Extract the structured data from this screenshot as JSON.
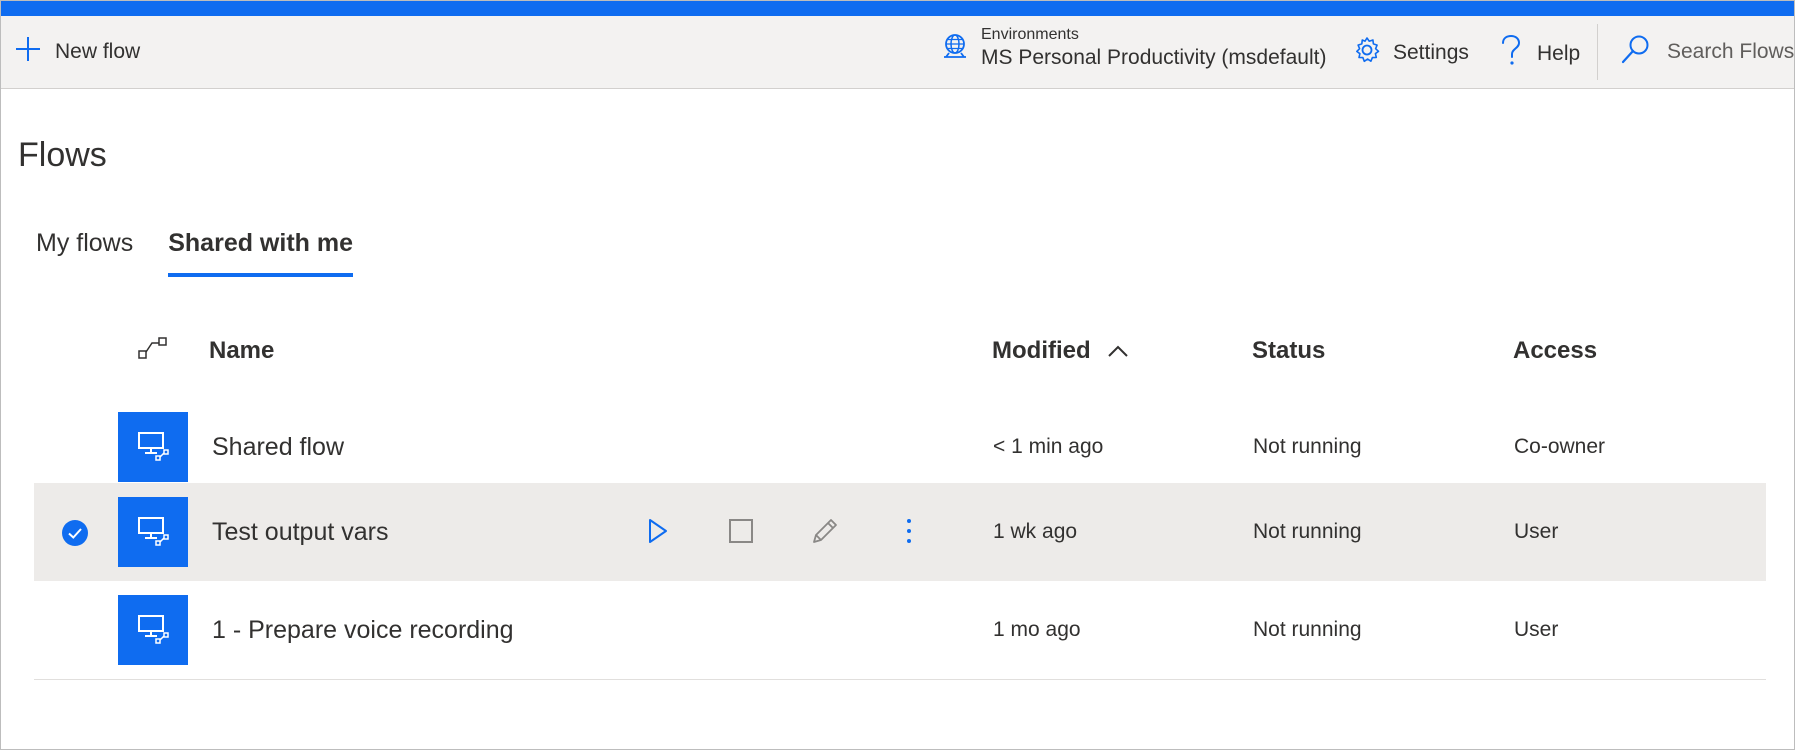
{
  "commandbar": {
    "new_flow_label": "New flow",
    "environments_caption": "Environments",
    "environment_value": "MS Personal Productivity (msdefault)",
    "settings_label": "Settings",
    "help_label": "Help",
    "search_placeholder": "Search Flows"
  },
  "page": {
    "title": "Flows",
    "tabs": [
      {
        "label": "My flows",
        "active": false
      },
      {
        "label": "Shared with me",
        "active": true
      }
    ]
  },
  "table": {
    "headers": {
      "name": "Name",
      "modified": "Modified",
      "status": "Status",
      "access": "Access"
    },
    "sort": {
      "column": "Modified",
      "direction": "ascending"
    },
    "rows": [
      {
        "name": "Shared flow",
        "modified": "< 1 min ago",
        "status": "Not running",
        "access": "Co-owner",
        "selected": false
      },
      {
        "name": "Test output vars",
        "modified": "1 wk ago",
        "status": "Not running",
        "access": "User",
        "selected": true
      },
      {
        "name": "1 - Prepare voice recording",
        "modified": "1 mo ago",
        "status": "Not running",
        "access": "User",
        "selected": false
      }
    ]
  },
  "colors": {
    "accent": "#0f6cf0",
    "command_bar": "#f3f2f1",
    "selected_row": "#edebe9",
    "text": "#323130"
  },
  "icons": {
    "new_flow": "plus-icon",
    "environments": "globe-icon",
    "settings": "gear-icon",
    "help": "question-icon",
    "search": "search-icon",
    "flow_tile": "desktop-flow-icon",
    "row_actions": [
      "run-icon",
      "stop-icon",
      "edit-icon",
      "more-icon"
    ]
  }
}
